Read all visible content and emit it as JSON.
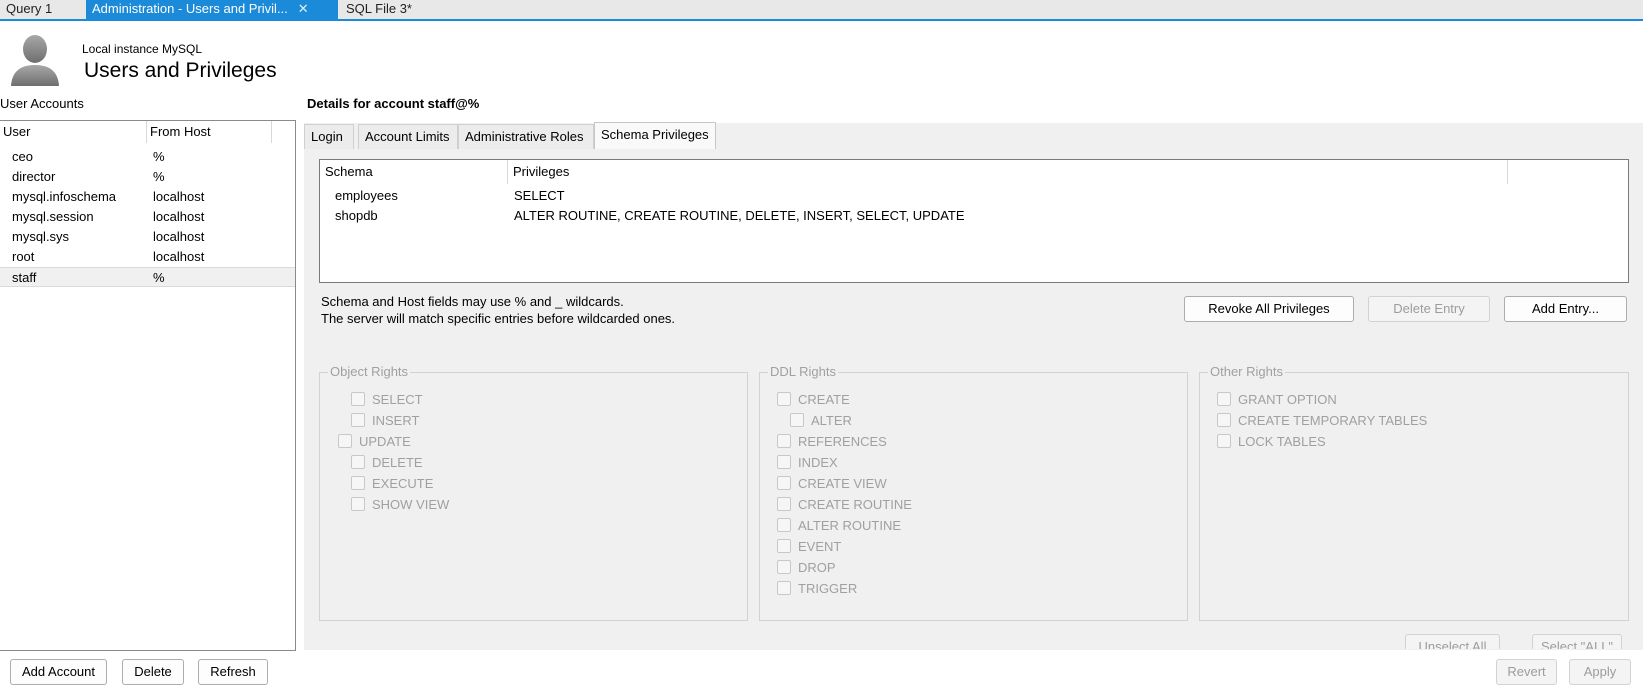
{
  "tabs": [
    {
      "label": "Query 1",
      "active": false
    },
    {
      "label": "Administration - Users and Privil...",
      "active": true
    },
    {
      "label": "SQL File 3*",
      "active": false
    }
  ],
  "header": {
    "instance": "Local instance MySQL",
    "title": "Users and Privileges"
  },
  "accounts": {
    "label": "User Accounts",
    "columns": [
      "User",
      "From Host"
    ],
    "rows": [
      {
        "user": "ceo",
        "host": "%"
      },
      {
        "user": "director",
        "host": "%"
      },
      {
        "user": "mysql.infoschema",
        "host": "localhost"
      },
      {
        "user": "mysql.session",
        "host": "localhost"
      },
      {
        "user": "mysql.sys",
        "host": "localhost"
      },
      {
        "user": "root",
        "host": "localhost"
      },
      {
        "user": "staff",
        "host": "%"
      }
    ],
    "selected": "staff",
    "buttons": {
      "add": "Add Account",
      "delete": "Delete",
      "refresh": "Refresh"
    }
  },
  "details": {
    "title": "Details for account staff@%",
    "tabs": [
      "Login",
      "Account Limits",
      "Administrative Roles",
      "Schema Privileges"
    ],
    "active_tab": "Schema Privileges",
    "grid": {
      "columns": [
        "Schema",
        "Privileges"
      ],
      "rows": [
        {
          "schema": "employees",
          "privileges": "SELECT"
        },
        {
          "schema": "shopdb",
          "privileges": "ALTER ROUTINE, CREATE ROUTINE, DELETE, INSERT, SELECT, UPDATE"
        }
      ]
    },
    "hint_line1": "Schema and Host fields may use % and _ wildcards.",
    "hint_line2": "The server will match specific entries before wildcarded ones.",
    "buttons": {
      "revoke": "Revoke All Privileges",
      "delete_entry": "Delete Entry",
      "add_entry": "Add Entry...",
      "unselect_all": "Unselect All",
      "select_all": "Select \"ALL\""
    },
    "object_rights": {
      "title": "Object Rights",
      "items": [
        "SELECT",
        "INSERT",
        "UPDATE",
        "DELETE",
        "EXECUTE",
        "SHOW VIEW"
      ]
    },
    "ddl_rights": {
      "title": "DDL Rights",
      "items": [
        "CREATE",
        "ALTER",
        "REFERENCES",
        "INDEX",
        "CREATE VIEW",
        "CREATE ROUTINE",
        "ALTER ROUTINE",
        "EVENT",
        "DROP",
        "TRIGGER"
      ]
    },
    "other_rights": {
      "title": "Other Rights",
      "items": [
        "GRANT OPTION",
        "CREATE TEMPORARY TABLES",
        "LOCK TABLES"
      ]
    }
  },
  "footer": {
    "revert": "Revert",
    "apply": "Apply"
  }
}
